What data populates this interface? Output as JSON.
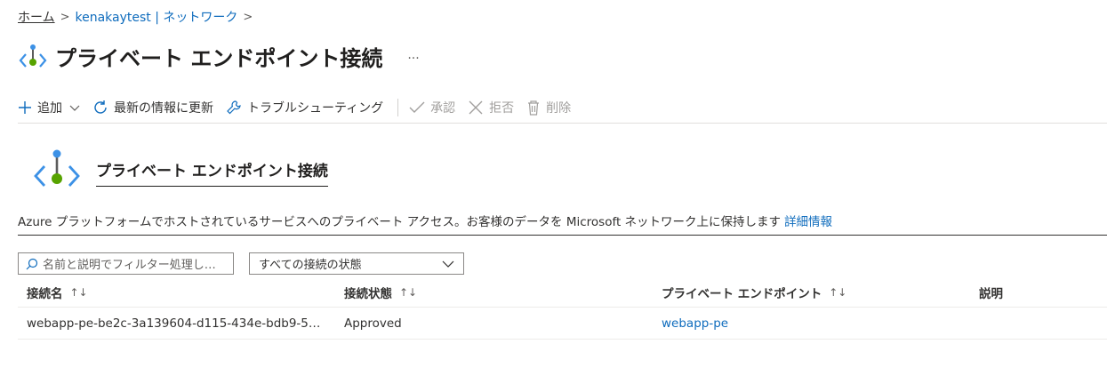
{
  "breadcrumb": {
    "home": "ホーム",
    "resource": "kenakaytest | ネットワーク"
  },
  "page": {
    "title": "プライベート エンドポイント接続",
    "more": "···"
  },
  "toolbar": {
    "add": "追加",
    "refresh": "最新の情報に更新",
    "troubleshoot": "トラブルシューティング",
    "approve": "承認",
    "reject": "拒否",
    "delete": "削除"
  },
  "section": {
    "title": "プライベート エンドポイント接続"
  },
  "description": {
    "text": "Azure プラットフォームでホストされているサービスへのプライベート アクセス。お客様のデータを Microsoft ネットワーク上に保持します",
    "link": "詳細情報"
  },
  "filter": {
    "placeholder": "名前と説明でフィルター処理し…"
  },
  "status_select": {
    "value": "すべての接続の状態"
  },
  "table": {
    "headers": [
      "接続名",
      "接続状態",
      "プライベート エンドポイント",
      "説明"
    ],
    "rows": [
      {
        "name": "webapp-pe-be2c-3a139604-d115-434e-bdb9-5…",
        "status": "Approved",
        "endpoint": "webapp-pe",
        "description": ""
      }
    ]
  },
  "colors": {
    "accent": "#0f6cbd",
    "icon_blue": "#3c91e6",
    "icon_green": "#57a300"
  }
}
